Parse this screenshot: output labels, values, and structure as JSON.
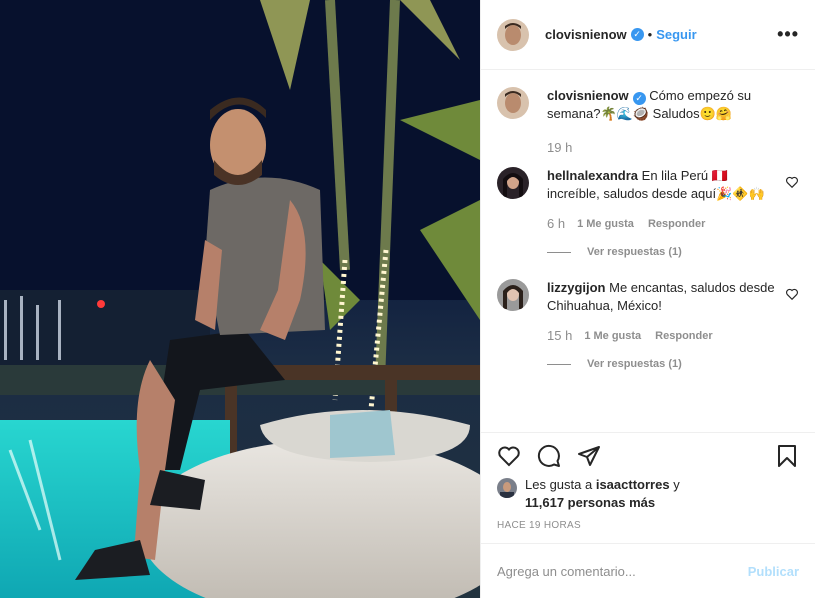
{
  "post": {
    "username": "clovisnienow",
    "follow_label": "Seguir",
    "dot": "•",
    "more_label": "•••"
  },
  "caption": {
    "username": "clovisnienow",
    "text": "Cómo empezó su semana?🌴🌊🥥 Saludos🙂🤗",
    "time": "19 h"
  },
  "comments": [
    {
      "username": "hellnalexandra",
      "text": "En lila Perú 🇵🇪 increíble, saludos desde aquí🎉🚸🙌",
      "time": "6 h",
      "likes_label": "1 Me gusta",
      "reply_label": "Responder",
      "view_replies": "Ver respuestas (1)"
    },
    {
      "username": "lizzygijon",
      "text": "Me encantas, saludos desde Chihuahua, México!",
      "time": "15 h",
      "likes_label": "1 Me gusta",
      "reply_label": "Responder",
      "view_replies": "Ver respuestas (1)"
    }
  ],
  "likes": {
    "prefix": "Les gusta a",
    "user": "isaacttorres",
    "joiner": "y",
    "others": "11,617 personas más"
  },
  "timestamp": "HACE 19 HORAS",
  "composer": {
    "placeholder": "Agrega un comentario...",
    "publish_label": "Publicar"
  },
  "icons": {
    "verified": "verified-badge-icon",
    "like": "heart-icon",
    "comment": "comment-icon",
    "share": "share-icon",
    "save": "bookmark-icon",
    "options": "more-options-icon"
  },
  "colors": {
    "accent": "#3897f0",
    "muted": "#8e8e8e",
    "publish_disabled": "#b2dffc",
    "border": "#efefef"
  }
}
